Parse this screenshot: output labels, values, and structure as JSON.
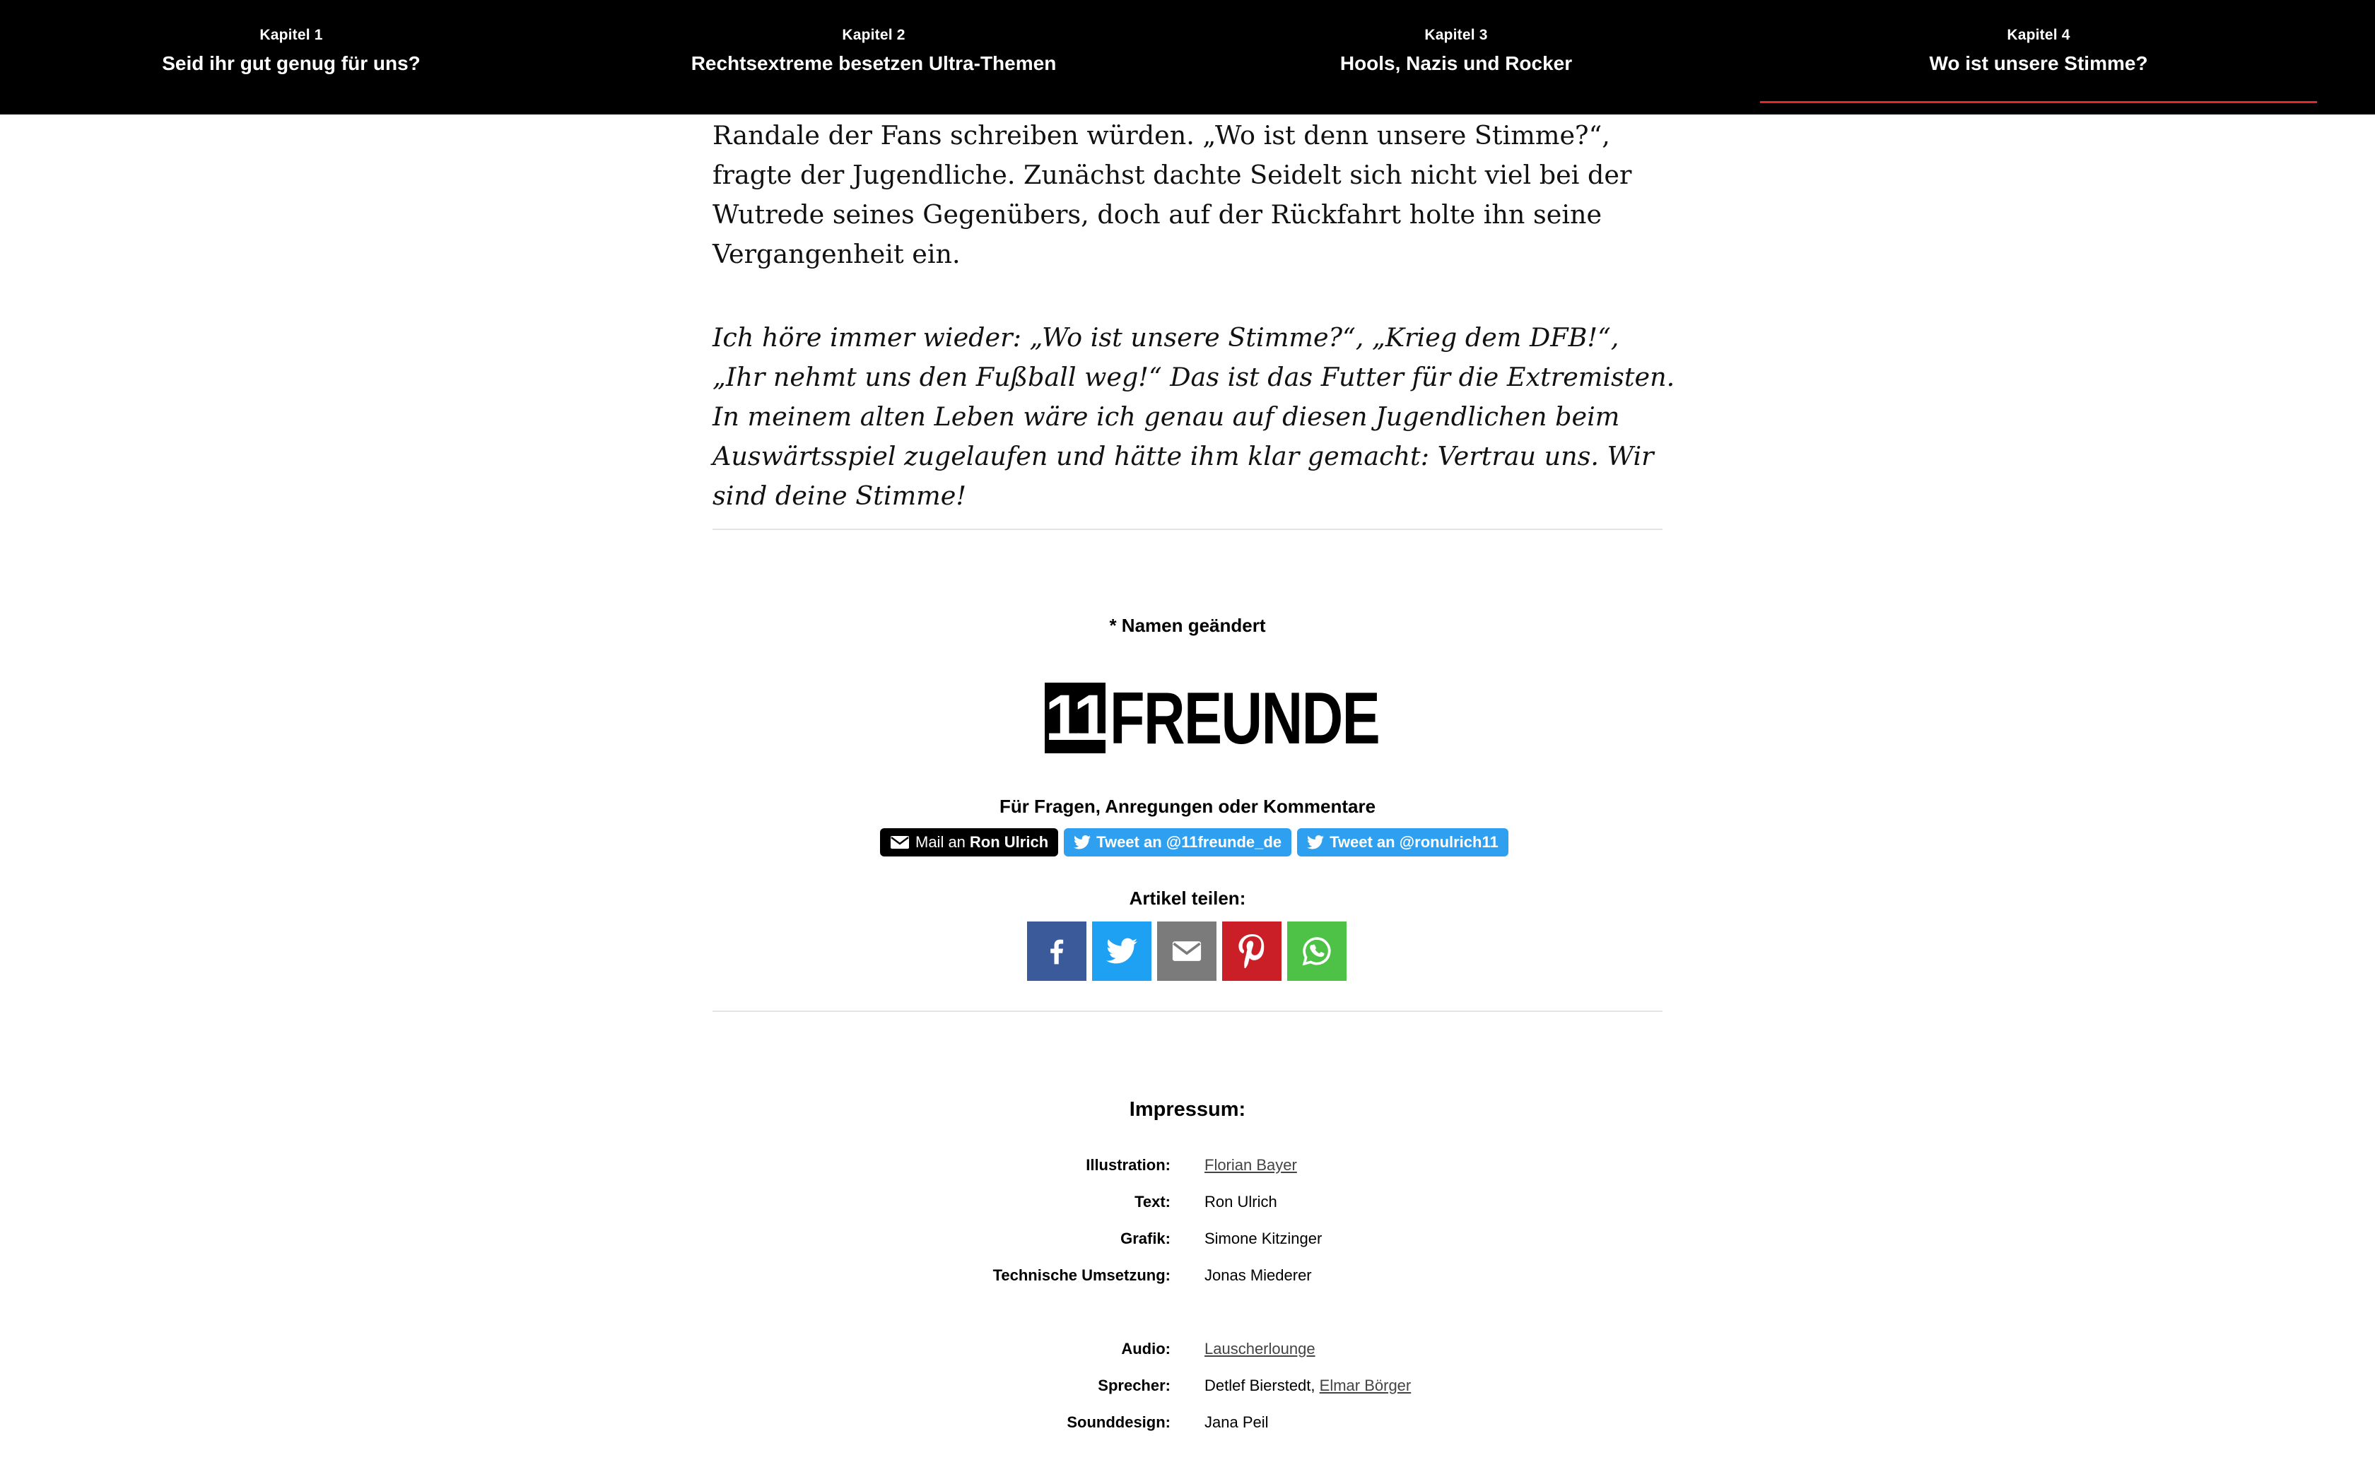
{
  "chapters": [
    {
      "label": "Kapitel 1",
      "title": "Seid ihr gut genug für uns?"
    },
    {
      "label": "Kapitel 2",
      "title": "Rechtsextreme besetzen Ultra-Themen"
    },
    {
      "label": "Kapitel 3",
      "title": "Hools, Nazis und Rocker"
    },
    {
      "label": "Kapitel 4",
      "title": "Wo ist unsere Stimme?"
    }
  ],
  "active_chapter": 4,
  "article": {
    "paragraph": "Randale der Fans schreiben würden. „Wo ist denn unsere Stimme?“, fragte der Jugendliche. Zunächst dachte Seidelt sich nicht viel bei der Wutrede seines Gegenübers, doch auf der Rückfahrt holte ihn seine Vergangenheit ein.",
    "quote": "Ich höre immer wieder: „Wo ist unsere Stimme?“, „Krieg dem DFB!“, „Ihr nehmt uns den Fußball weg!“ Das ist das Futter für die Extremisten. In meinem alten Leben wäre ich genau auf diesen Jugendlichen beim Auswärtsspiel zugelaufen und hätte ihm klar gemacht: Vertrau uns. Wir sind deine Stimme!"
  },
  "footnote": "* Namen geändert",
  "logo": {
    "number": "11",
    "word": "FREUNDE"
  },
  "contact": {
    "title": "Für Fragen, Anregungen oder Kommentare",
    "mail_prefix": "Mail an",
    "mail_name": "Ron Ulrich",
    "tweet1": "Tweet an @11freunde_de",
    "tweet2": "Tweet an @ronulrich11"
  },
  "share": {
    "title": "Artikel teilen:",
    "icons": [
      "facebook-icon",
      "twitter-icon",
      "email-icon",
      "pinterest-icon",
      "whatsapp-icon"
    ]
  },
  "impressum": {
    "title": "Impressum:",
    "rows": [
      {
        "label": "Illustration:",
        "value": "Florian Bayer"
      },
      {
        "label": "Text:",
        "value": "Ron Ulrich"
      },
      {
        "label": "Grafik:",
        "value": "Simone Kitzinger"
      },
      {
        "label": "Technische Umsetzung:",
        "value": "Jonas Miederer"
      },
      {
        "label": "Audio:",
        "value": "Lauscherlounge"
      },
      {
        "label": "Sprecher:",
        "value": "Detlef Bierstedt",
        "value2": "Elmar Börger"
      },
      {
        "label": "Sounddesign:",
        "value": "Jana Peil"
      }
    ]
  },
  "colors": {
    "nav_background": "#000000",
    "active_underline": "#e3262d",
    "twitter_blue": "#2fa0f0",
    "facebook": "#3b5a9a",
    "pinterest": "#cb1f27",
    "whatsapp": "#4dc247"
  }
}
